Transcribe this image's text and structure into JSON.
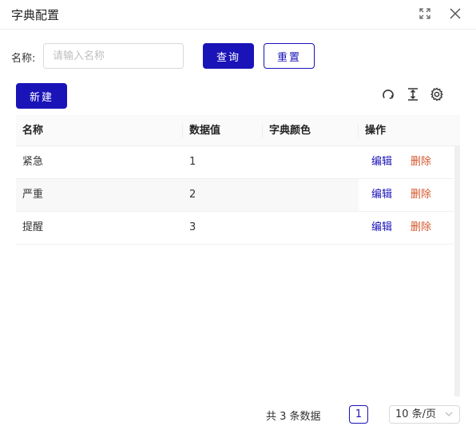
{
  "dialog": {
    "title": "字典配置",
    "icons": {
      "expand": "expand-icon",
      "close": "close-icon"
    }
  },
  "search": {
    "label": "名称:",
    "placeholder": "请输入名称",
    "value": "",
    "query_label": "查询",
    "reset_label": "重置"
  },
  "toolbar": {
    "new_label": "新建",
    "icons": [
      "refresh-icon",
      "column-height-icon",
      "settings-icon"
    ]
  },
  "table": {
    "columns": [
      "名称",
      "数据值",
      "字典颜色",
      "操作"
    ],
    "rows": [
      {
        "name": "紧急",
        "value": "1",
        "color": "",
        "edit": "编辑",
        "delete": "删除"
      },
      {
        "name": "严重",
        "value": "2",
        "color": "",
        "edit": "编辑",
        "delete": "删除"
      },
      {
        "name": "提醒",
        "value": "3",
        "color": "",
        "edit": "编辑",
        "delete": "删除"
      }
    ]
  },
  "pagination": {
    "total_text": "共 3 条数据",
    "current_page": "1",
    "page_size": "10 条/页"
  },
  "colors": {
    "primary": "#1a13b8",
    "danger": "#d4572b",
    "header_bg": "#fafafa",
    "stripe_bg": "#f8f8f8"
  }
}
